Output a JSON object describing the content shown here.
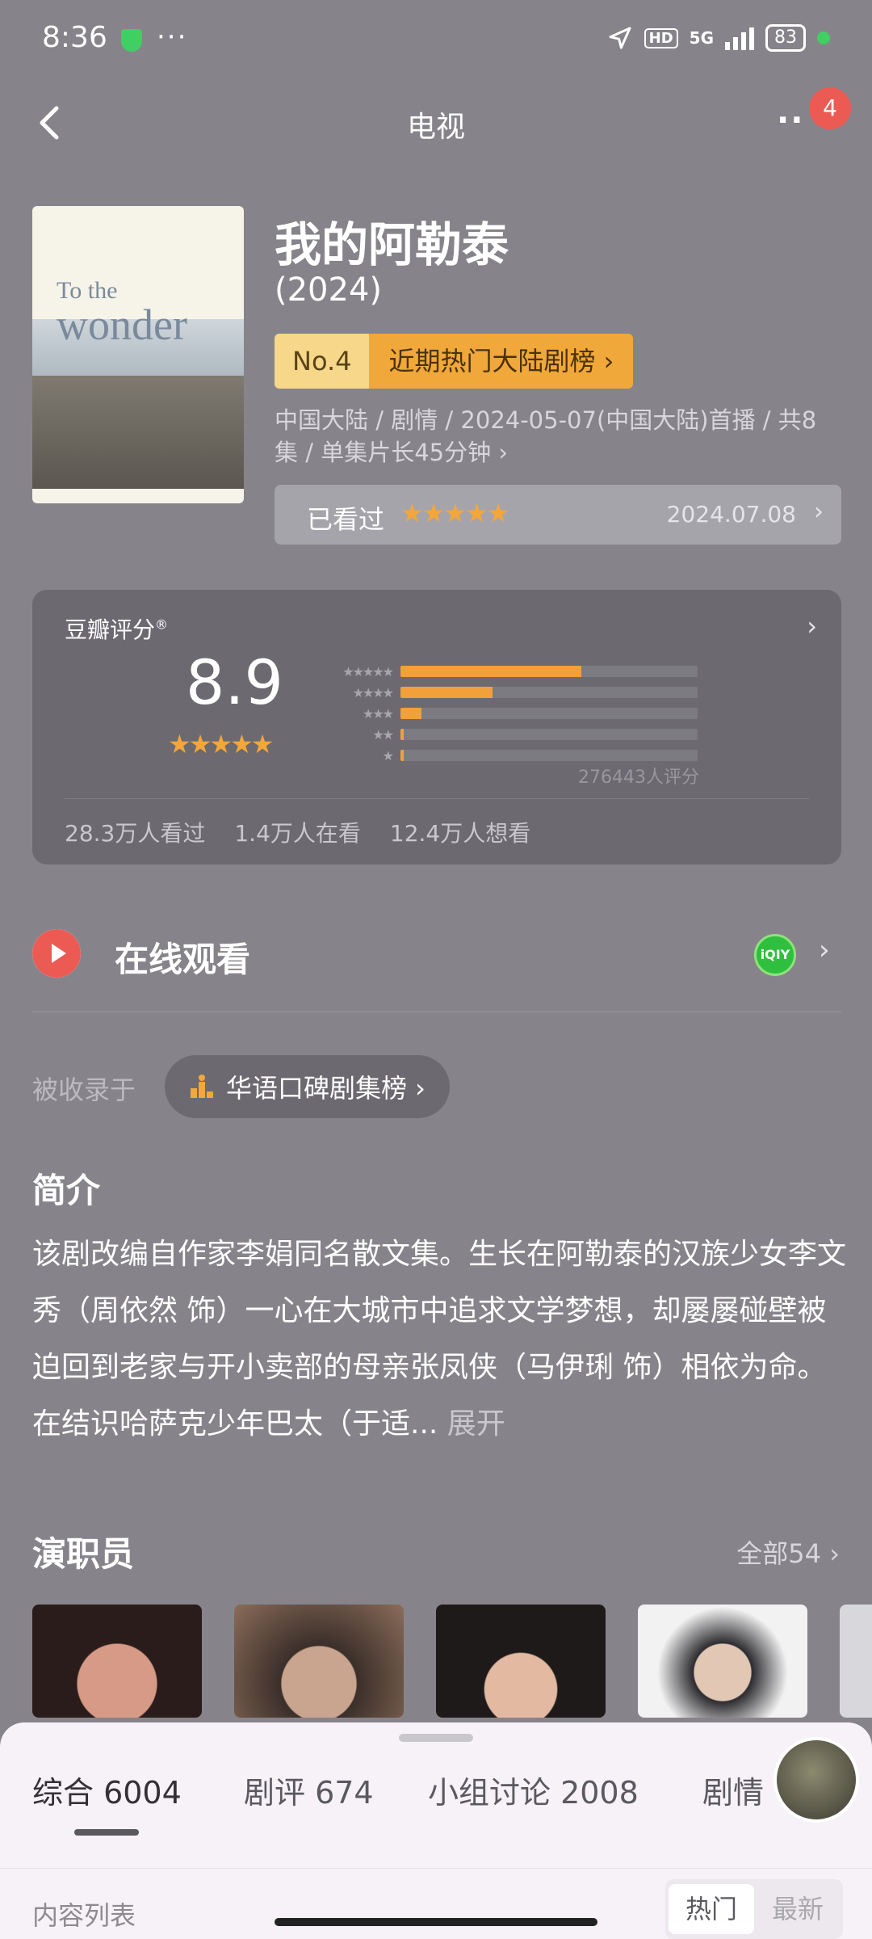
{
  "status_bar": {
    "time": "8:36",
    "dots": "···",
    "network_hd": "HD",
    "network_5g": "5G",
    "battery": "83"
  },
  "nav": {
    "title": "电视",
    "more": "··",
    "badge_count": "4"
  },
  "show": {
    "title": "我的阿勒泰",
    "year": "(2024)",
    "rank_no": "No.4",
    "rank_name": "近期热门大陆剧榜 ›",
    "meta": "中国大陆 / 剧情 / 2024-05-07(中国大陆)首播 / 共8集 / 单集片长45分钟 ›",
    "poster_title": "To the",
    "poster_title2": "wonder",
    "watched_label": "已看过",
    "watched_stars": "★★★★★",
    "watched_date": "2024.07.08",
    "watched_arrow": "›"
  },
  "rating": {
    "label": "豆瓣评分",
    "label_mark": "®",
    "arrow": "›",
    "score": "8.9",
    "stars": "★★★★★",
    "distribution": [
      {
        "stars": "★★★★★",
        "fraction": 0.61
      },
      {
        "stars": "★★★★",
        "fraction": 0.31
      },
      {
        "stars": "★★★",
        "fraction": 0.07
      },
      {
        "stars": "★★",
        "fraction": 0.01
      },
      {
        "stars": "★",
        "fraction": 0.01
      }
    ],
    "count": "276443人评分",
    "stats": [
      "28.3万人看过",
      "1.4万人在看",
      "12.4万人想看"
    ]
  },
  "online": {
    "title": "在线观看",
    "provider_icon": "iQIY",
    "arrow": "›"
  },
  "included": {
    "label": "被收录于",
    "chart_name": "华语口碑剧集榜 ›"
  },
  "intro": {
    "title": "简介",
    "text": "该剧改编自作家李娟同名散文集。生长在阿勒泰的汉族少女李文秀（周依然 饰）一心在大城市中追求文学梦想，却屡屡碰壁被迫回到老家与开小卖部的母亲张凤侠（马伊琍 饰）相依为命。在结识哈萨克少年巴太（于适...",
    "more": "展开"
  },
  "cast": {
    "title": "演职员",
    "all": "全部54 ›"
  },
  "sheet": {
    "tabs": [
      "综合 6004",
      "剧评 674",
      "小组讨论 2008",
      "剧情"
    ],
    "list_label": "内容列表",
    "sort_hot": "热门",
    "sort_new": "最新"
  },
  "colors": {
    "accent": "#f1a83a",
    "background": "#86848a",
    "card": "#6c6a70",
    "badge": "#ec5a54"
  }
}
